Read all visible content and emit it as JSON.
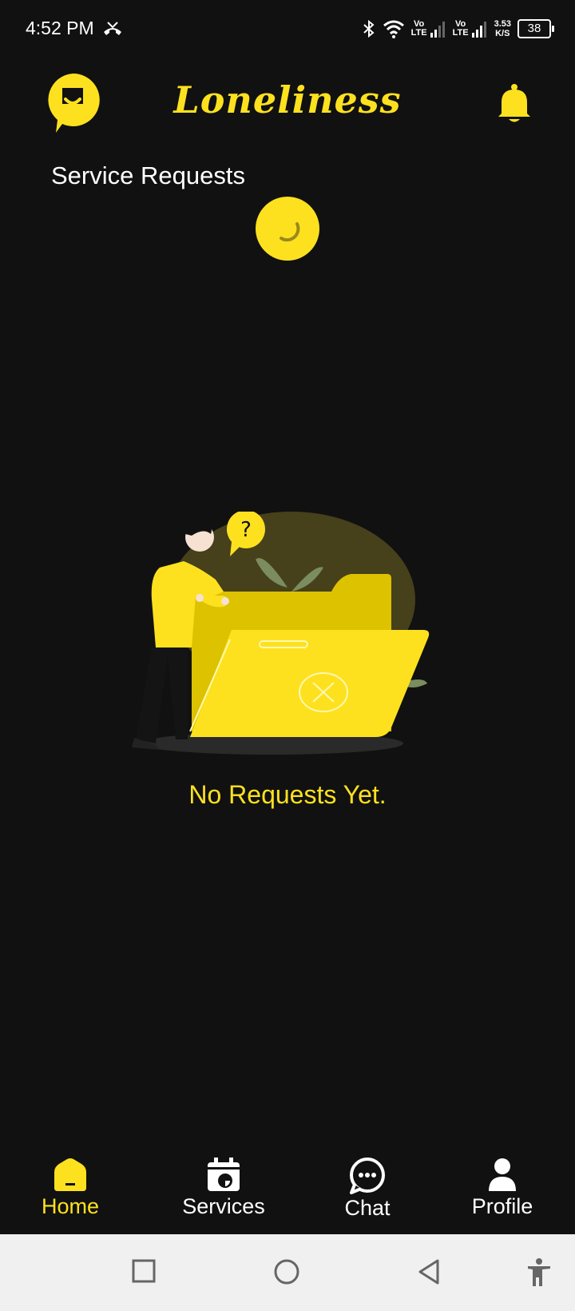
{
  "status_bar": {
    "time": "4:52 PM",
    "volte1": "Vo\nLTE",
    "volte2": "Vo\nLTE",
    "speed_value": "3.53",
    "speed_unit": "K/S",
    "battery": "38"
  },
  "header": {
    "app_title": "Loneliness"
  },
  "main": {
    "section_title": "Service Requests",
    "empty_message": "No Requests Yet."
  },
  "bottom_nav": {
    "items": [
      {
        "label": "Home",
        "icon": "home-icon",
        "active": true
      },
      {
        "label": "Services",
        "icon": "calendar-icon",
        "active": false
      },
      {
        "label": "Chat",
        "icon": "chat-icon",
        "active": false
      },
      {
        "label": "Profile",
        "icon": "profile-icon",
        "active": false
      }
    ]
  },
  "colors": {
    "accent": "#FDE11F",
    "background": "#111111",
    "system_nav": "#F0F0F0"
  }
}
